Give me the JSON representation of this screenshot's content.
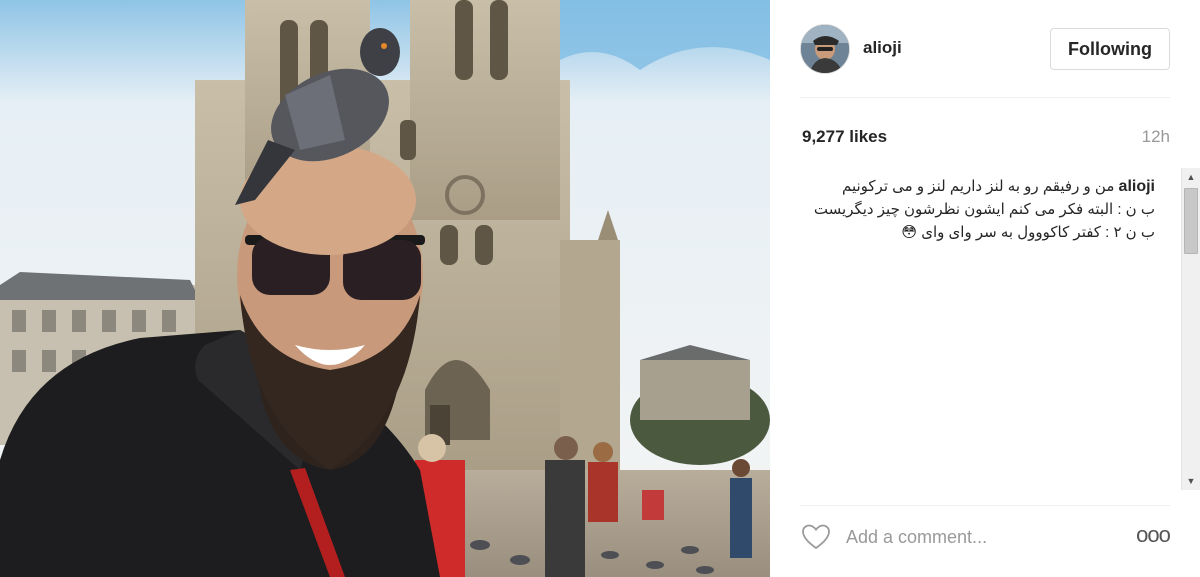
{
  "post": {
    "photo_alt": "",
    "user": {
      "username": "alioji",
      "follow_label": "Following"
    },
    "likes": "9,277 likes",
    "time_ago": "12h",
    "caption": {
      "username": "alioji",
      "text": "من و رفیقم رو به لنز داریم لنز و می ترکونیم\nب ن : البته فکر می کنم ایشون نظرشون چیز دیگریست\nب ن ۲ : کفتر کاکووول به سر وای وای 😳"
    },
    "comment": {
      "placeholder": "Add a comment...",
      "value": ""
    },
    "more_label": "ooo"
  },
  "icons": {
    "heart": "heart-outline-icon",
    "more": "more-options-icon",
    "scroll_up": "scroll-up-arrow-icon",
    "scroll_down": "scroll-down-arrow-icon"
  },
  "colors": {
    "text": "#262626",
    "muted": "#999999",
    "border": "#dbdbdb"
  }
}
